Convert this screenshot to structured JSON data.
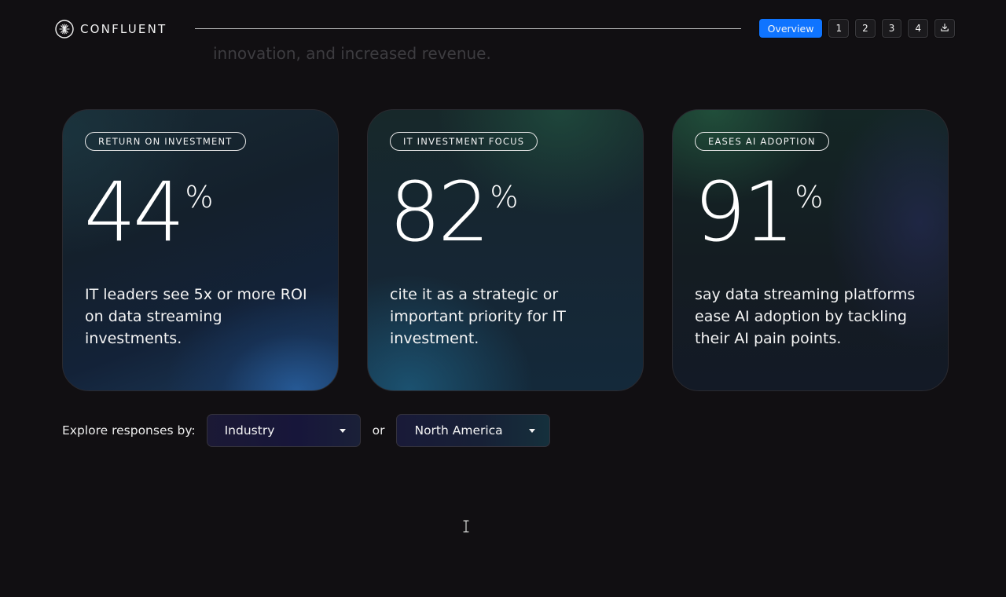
{
  "header": {
    "brand": "CONFLUENT",
    "nav": [
      {
        "label": "Overview",
        "active": true
      },
      {
        "label": "1",
        "active": false
      },
      {
        "label": "2",
        "active": false
      },
      {
        "label": "3",
        "active": false
      },
      {
        "label": "4",
        "active": false
      }
    ],
    "download_icon": "download-icon"
  },
  "intro_text": "innovation, and increased revenue.",
  "cards": [
    {
      "tag": "RETURN ON INVESTMENT",
      "value": "44",
      "unit": "%",
      "description": "IT leaders see 5x or more ROI on data streaming investments."
    },
    {
      "tag": "IT INVESTMENT FOCUS",
      "value": "82",
      "unit": "%",
      "description": "cite it as a strategic or important priority for IT investment."
    },
    {
      "tag": "EASES AI ADOPTION",
      "value": "91",
      "unit": "%",
      "description": "say data streaming platforms ease AI adoption by tackling their AI pain points."
    }
  ],
  "explore": {
    "label": "Explore responses by:",
    "select_1": "Industry",
    "or": "or",
    "select_2": "North America"
  },
  "colors": {
    "background": "#110f12",
    "accent": "#0f74ff"
  }
}
